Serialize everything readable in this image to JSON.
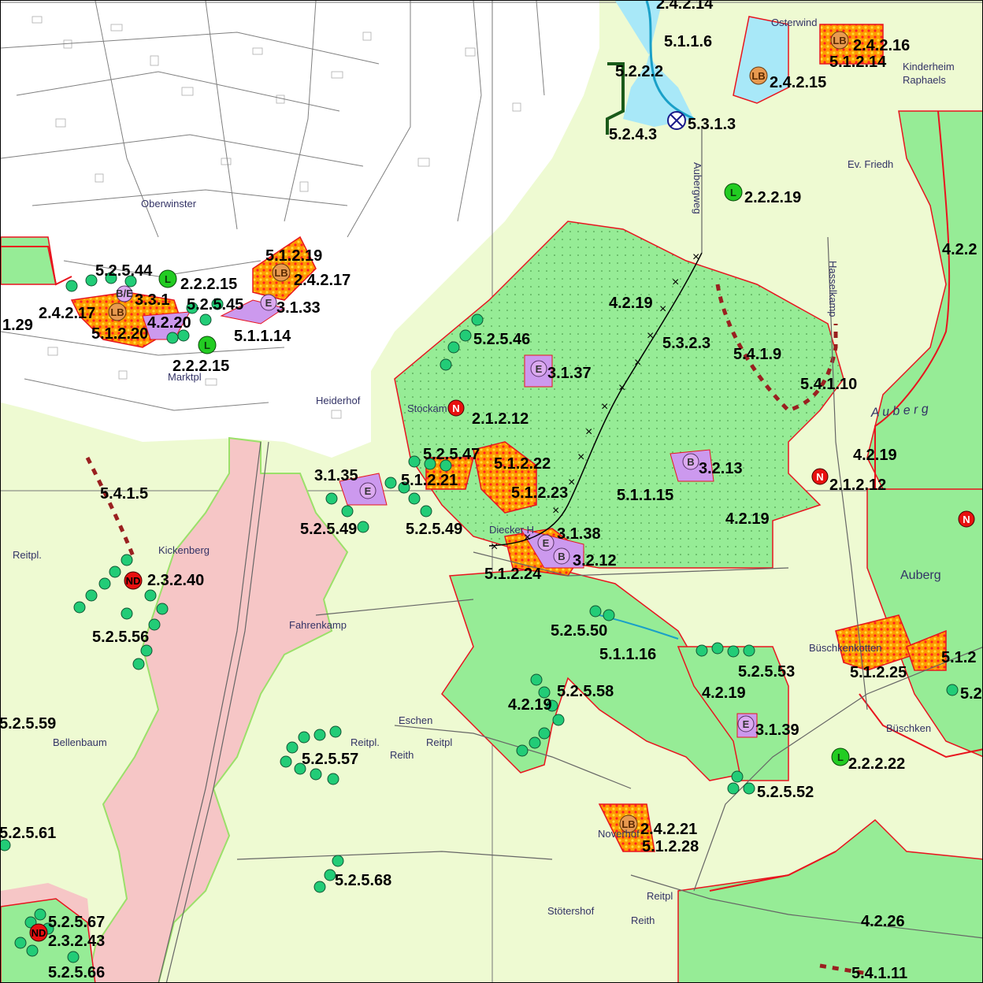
{
  "map": {
    "colors": {
      "background": "#eefad2",
      "urban": "#ffffff",
      "settlement_pink": "#f6c6c6",
      "forest": "#96ec96",
      "water": "#a8e8f8",
      "protected_hatch": "#ff9a00",
      "orchid_area": "#cc99ee",
      "boundary_red": "#e8141e",
      "dashed_brown": "#9a2020"
    },
    "codes": {
      "c_2_4_2_14": "2.4.2.14",
      "c_5_1_1_6": "5.1.1.6",
      "c_2_4_2_16": "2.4.2.16",
      "c_5_1_2_14": "5.1.2.14",
      "c_5_2_2_2": "5.2.2.2",
      "c_2_4_2_15": "2.4.2.15",
      "c_5_3_1_3": "5.3.1.3",
      "c_5_2_4_3": "5.2.4.3",
      "c_2_2_2_19": "2.2.2.19",
      "c_4_2_2": "4.2.2",
      "c_5_1_2_19": "5.1.2.19",
      "c_2_4_2_17": "2.4.2.17",
      "c_5_2_5_44": "5.2.5.44",
      "c_2_2_2_15a": "2.2.2.15",
      "c_3_3_1": "3.3.1",
      "c_5_2_5_45": "5.2.5.45",
      "c_3_1_33": "3.1.33",
      "c_2_4_2_17b": "2.4.2.17",
      "c_4_2_20": "4.2.20",
      "c_1_29": "1.29",
      "c_5_1_2_20": "5.1.2.20",
      "c_5_1_1_14": "5.1.1.14",
      "c_2_2_2_15b": "2.2.2.15",
      "c_4_2_19a": "4.2.19",
      "c_5_3_2_3": "5.3.2.3",
      "c_5_4_1_9": "5.4.1.9",
      "c_5_2_5_46": "5.2.5.46",
      "c_3_1_37": "3.1.37",
      "c_5_4_1_10": "5.4.1.10",
      "c_2_1_2_12a": "2.1.2.12",
      "c_4_2_19b": "4.2.19",
      "c_5_2_5_47": "5.2.5.47",
      "c_5_1_2_22": "5.1.2.22",
      "c_3_1_35": "3.1.35",
      "c_5_1_2_21": "5.1.2.21",
      "c_3_2_13": "3.2.13",
      "c_2_1_2_12b": "2.1.2.12",
      "c_5_4_1_5": "5.4.1.5",
      "c_5_1_2_23": "5.1.2.23",
      "c_5_1_1_15": "5.1.1.15",
      "c_4_2_19c": "4.2.19",
      "c_5_2_5_49a": "5.2.5.49",
      "c_5_2_5_49b": "5.2.5.49",
      "c_3_1_38": "3.1.38",
      "c_2_3_2_40": "2.3.2.40",
      "c_3_2_12": "3.2.12",
      "c_5_1_2_24": "5.1.2.24",
      "c_5_2_5_50": "5.2.5.50",
      "c_5_2_5_56": "5.2.5.56",
      "c_5_1_1_16": "5.1.1.16",
      "c_5_2_5_53": "5.2.5.53",
      "c_5_1_2_25": "5.1.2.25",
      "c_5_1_2_edge": "5.1.2",
      "c_5_2_5_58": "5.2.5.58",
      "c_4_2_19d": "4.2.19",
      "c_4_2_19e": "4.2.19",
      "c_5_2_5_59": "5.2.5.59",
      "c_3_1_39": "3.1.39",
      "c_5_2_5_57": "5.2.5.57",
      "c_2_2_2_22": "2.2.2.22",
      "c_5_2_5_52": "5.2.5.52",
      "c_5_2_5_61": "5.2.5.61",
      "c_2_4_2_21": "2.4.2.21",
      "c_5_1_2_28": "5.1.2.28",
      "c_5_2_5_68": "5.2.5.68",
      "c_4_2_26": "4.2.26",
      "c_5_2_5_67": "5.2.5.67",
      "c_2_3_2_43": "2.3.2.43",
      "c_5_4_1_11": "5.4.1.11",
      "c_5_2_5_66": "5.2.5.66",
      "c_5_2_edge": "5.2"
    },
    "places": {
      "osterwind": "Osterwind",
      "kinderheim": "Kinderheim",
      "raphaels": "Raphaels",
      "ev_friedh": "Ev. Friedh",
      "oberwinster": "Oberwinster",
      "heiderhof": "Heiderhof",
      "stockam": "Stockam",
      "auberg_italic": "A u b e r g",
      "auberg": "Auberg",
      "kickenberg": "Kickenberg",
      "reitpl1": "Reitpl.",
      "fahrenkamp": "Fahrenkamp",
      "dieckerhof": "Diecker H",
      "buschkenkotten": "Büschkenkotten",
      "buschken": "Büschken",
      "bellenbaum": "Bellenbaum",
      "reitpl2": "Reitpl.",
      "reith1": "Reith",
      "reitpl3": "Reitpl",
      "noverhof": "Noverhof",
      "reitpl4": "Reitpl",
      "stotershof": "Stötershof",
      "reith2": "Reith",
      "eschen": "Eschen",
      "aubergweg": "Aubergweg",
      "hasselkamp": "Hasselkamp",
      "marktplatz": "Marktpl"
    },
    "symbols": {
      "LB": "LB",
      "E": "E",
      "B": "B",
      "L": "L",
      "N": "N",
      "BE": "B/E",
      "ND": "ND"
    }
  }
}
